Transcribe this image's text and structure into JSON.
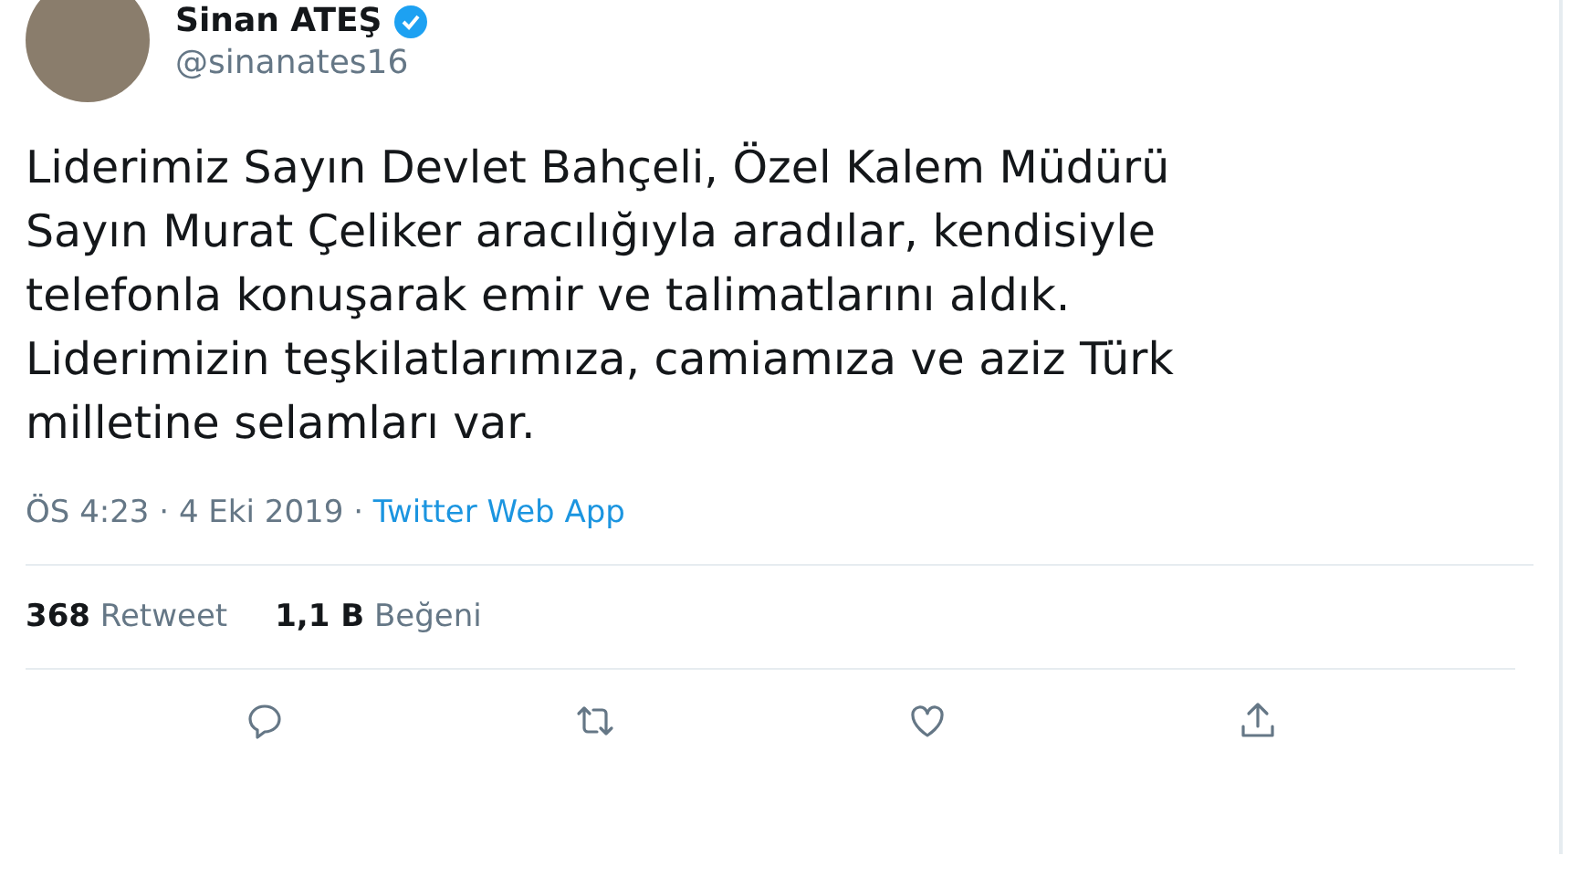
{
  "author": {
    "name": "Sinan ATEŞ",
    "verified": true,
    "handle": "@sinanates16"
  },
  "text": "Liderimiz Sayın Devlet Bahçeli, Özel Kalem Müdürü\nSayın Murat Çeliker aracılığıyla aradılar, kendisiyle\ntelefonla konuşarak emir ve talimatlarını aldık.\nLiderimizin teşkilatlarımıza, camiamıza ve aziz Türk\nmilletine selamları var.",
  "time": "ÖS 4:23 · 4 Eki 2019 · ",
  "source": "Twitter Web App",
  "stats": [
    {
      "count": "368",
      "label": "Retweet"
    },
    {
      "count": "1,1 B",
      "label": "Beğeni"
    }
  ],
  "actions": [
    {
      "kind": "reply"
    },
    {
      "kind": "retweet"
    },
    {
      "kind": "like"
    },
    {
      "kind": "share"
    }
  ]
}
